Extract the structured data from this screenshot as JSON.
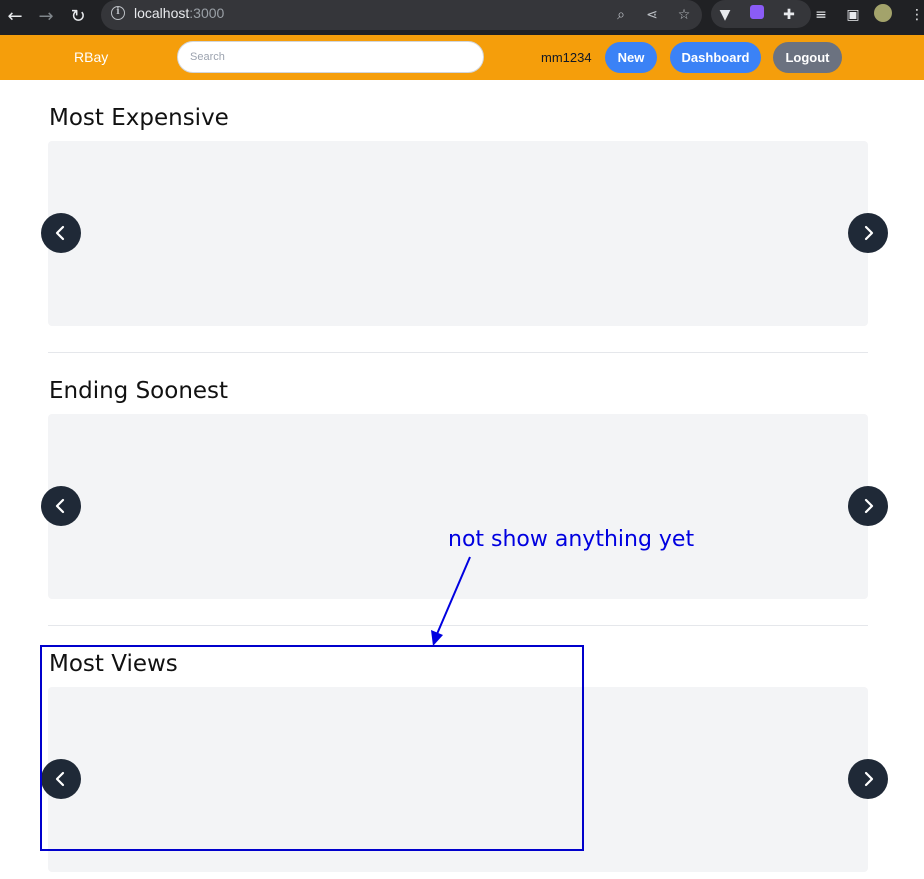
{
  "browser": {
    "url_host": "localhost",
    "url_port": ":3000"
  },
  "navbar": {
    "brand": "RBay",
    "search_placeholder": "Search",
    "username": "mm1234",
    "new_label": "New",
    "dashboard_label": "Dashboard",
    "logout_label": "Logout"
  },
  "sections": [
    {
      "title": "Most Expensive"
    },
    {
      "title": "Ending Soonest"
    },
    {
      "title": "Most Views"
    }
  ],
  "annotation": {
    "text": "not show anything yet",
    "color": "#0000cc"
  },
  "colors": {
    "navbar": "#f59e0b",
    "primary_button": "#3b82f6",
    "secondary_button": "#6b7280",
    "carousel_bg": "#f3f4f6",
    "arrow_button": "#1f2937"
  }
}
